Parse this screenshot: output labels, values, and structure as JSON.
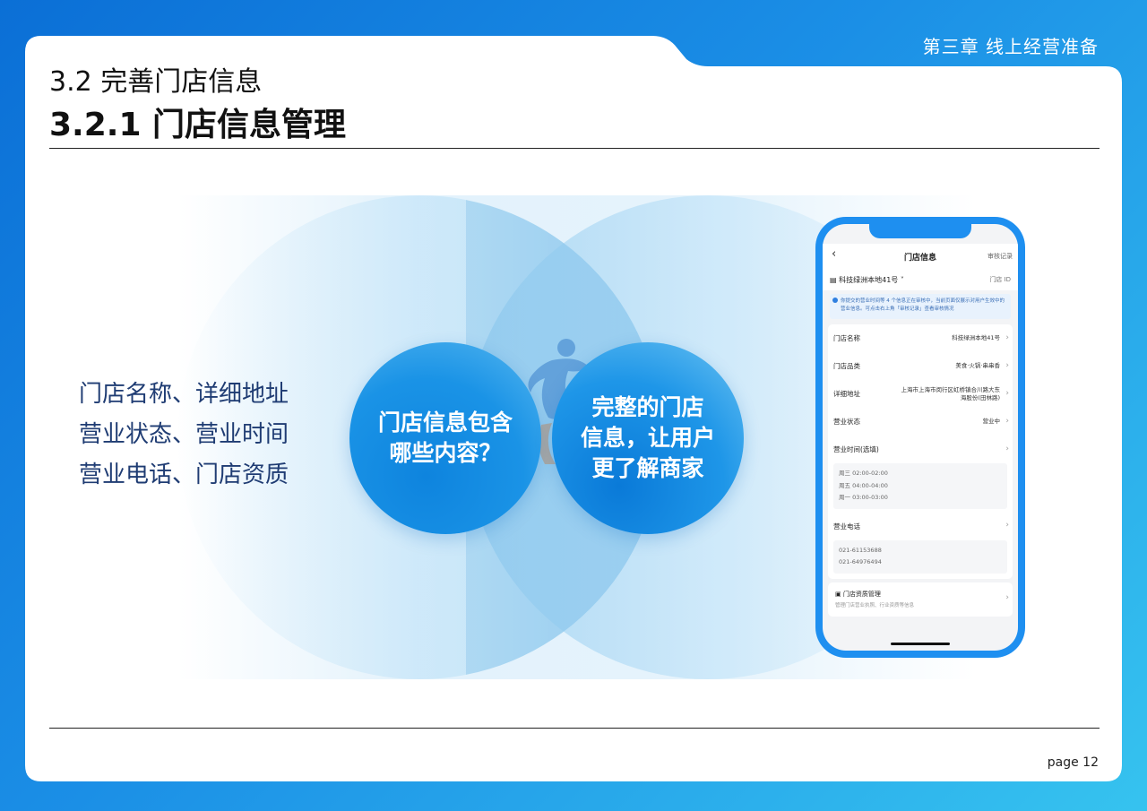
{
  "chapter": "第三章 线上经营准备",
  "subtitle": "3.2 完善门店信息",
  "title": "3.2.1 门店信息管理",
  "features": [
    "门店名称、详细地址",
    "营业状态、营业时间",
    "营业电话、门店资质"
  ],
  "circle_left": [
    "门店信息包含",
    "哪些内容？"
  ],
  "circle_right": [
    "完整的门店",
    "信息，让用户",
    "更了解商家"
  ],
  "page": "page 12",
  "phone": {
    "back_icon": "‹",
    "header_title": "门店信息",
    "audit_link": "审核记录",
    "store_name": "科技绿洲本地41号",
    "store_id_label": "门店 ID",
    "notice": "你提交的营业时间等 4 个信息正在审核中，当前页面仅展示对用户生效中的营业信息。可点击右上角「审核记录」查看审核情况",
    "fields": [
      {
        "label": "门店名称",
        "value": "科技绿洲本地41号"
      },
      {
        "label": "门店品类",
        "value": "美食·火锅·串串香"
      },
      {
        "label": "详细地址",
        "value": "上海市上海市闵行区虹桥镇合川路大东海股份(田林路)"
      },
      {
        "label": "营业状态",
        "value": "营业中"
      }
    ],
    "hours_label": "营业时间(选填)",
    "hours": [
      "周三 02:00-02:00",
      "周五 04:00-04:00",
      "周一 03:00-03:00"
    ],
    "phone_label": "营业电话",
    "phones": [
      "021-61153688",
      "021-64976494"
    ],
    "qual_title": "门店资质管理",
    "qual_desc": "管理门店营业执照、行业资质等信息"
  },
  "colors": {
    "primary": "#1a93e6",
    "text": "#111111",
    "feature_text": "#1f3c73"
  }
}
